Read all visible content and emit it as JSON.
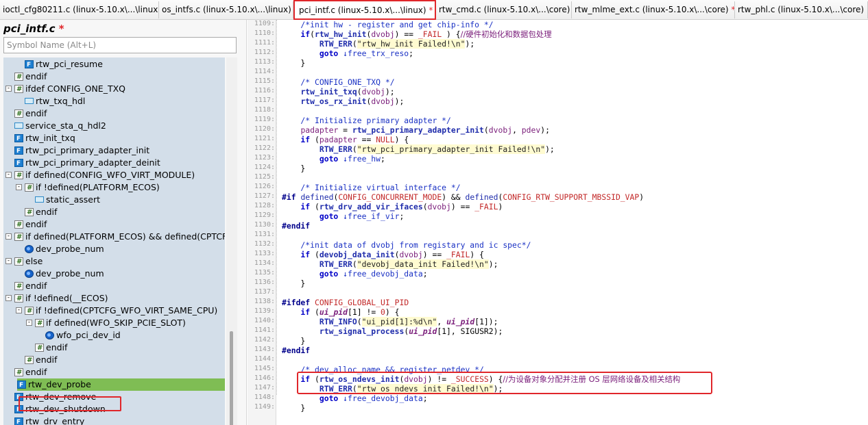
{
  "tabs": [
    {
      "label": "ioctl_cfg80211.c (linux-5.10.x\\...\\linux)",
      "active": false,
      "modified": false
    },
    {
      "label": "os_intfs.c (linux-5.10.x\\...\\linux)",
      "active": false,
      "modified": false
    },
    {
      "label": "pci_intf.c (linux-5.10.x\\...\\linux)",
      "active": true,
      "modified": true
    },
    {
      "label": "rtw_cmd.c (linux-5.10.x\\...\\core)",
      "active": false,
      "modified": false
    },
    {
      "label": "rtw_mlme_ext.c (linux-5.10.x\\...\\core)",
      "active": false,
      "modified": true
    },
    {
      "label": "rtw_phl.c (linux-5.10.x\\...\\core)",
      "active": false,
      "modified": false
    }
  ],
  "tab_symbols": {
    "modified": "*",
    "close": "×"
  },
  "panel": {
    "file_title": "pci_intf.c",
    "dirty_mark": "*",
    "search_placeholder": "Symbol Name (Alt+L)"
  },
  "tree": [
    {
      "label": "rtw_pci_resume",
      "icon": "function-icon"
    },
    {
      "label": "endif",
      "icon": "preprocessor-icon"
    },
    {
      "label": "ifdef CONFIG_ONE_TXQ",
      "icon": "preprocessor-icon",
      "toggle": "-"
    },
    {
      "label": "rtw_txq_hdl",
      "icon": "type-icon"
    },
    {
      "label": "endif",
      "icon": "preprocessor-icon"
    },
    {
      "label": "service_sta_q_hdl2",
      "icon": "type-icon"
    },
    {
      "label": "rtw_init_txq",
      "icon": "function-icon"
    },
    {
      "label": "rtw_pci_primary_adapter_init",
      "icon": "function-icon"
    },
    {
      "label": "rtw_pci_primary_adapter_deinit",
      "icon": "function-icon"
    },
    {
      "label": "if defined(CONFIG_WFO_VIRT_MODULE)",
      "icon": "preprocessor-icon",
      "toggle": "-"
    },
    {
      "label": "if !defined(PLATFORM_ECOS)",
      "icon": "preprocessor-icon",
      "toggle": "-"
    },
    {
      "label": "static_assert",
      "icon": "type-icon"
    },
    {
      "label": "endif",
      "icon": "preprocessor-icon"
    },
    {
      "label": "endif",
      "icon": "preprocessor-icon"
    },
    {
      "label": "if defined(PLATFORM_ECOS) && defined(CPTCFG_WFO_VIRT_MODULE)",
      "icon": "preprocessor-icon",
      "toggle": "-"
    },
    {
      "label": "dev_probe_num",
      "icon": "extern-icon"
    },
    {
      "label": "else",
      "icon": "preprocessor-icon",
      "toggle": "-"
    },
    {
      "label": "dev_probe_num",
      "icon": "extern-icon"
    },
    {
      "label": "endif",
      "icon": "preprocessor-icon"
    },
    {
      "label": "if !defined(__ECOS)",
      "icon": "preprocessor-icon",
      "toggle": "-"
    },
    {
      "label": "if !defined(CPTCFG_WFO_VIRT_SAME_CPU)",
      "icon": "preprocessor-icon",
      "toggle": "-"
    },
    {
      "label": "if defined(WFO_SKIP_PCIE_SLOT)",
      "icon": "preprocessor-icon",
      "toggle": "-"
    },
    {
      "label": "wfo_pci_dev_id",
      "icon": "extern-icon"
    },
    {
      "label": "endif",
      "icon": "preprocessor-icon"
    },
    {
      "label": "endif",
      "icon": "preprocessor-icon"
    },
    {
      "label": "endif",
      "icon": "preprocessor-icon"
    },
    {
      "label": "rtw_dev_probe",
      "icon": "function-icon",
      "selected": true
    },
    {
      "label": "rtw_dev_remove",
      "icon": "function-icon"
    },
    {
      "label": "rtw_dev_shutdown",
      "icon": "function-icon"
    },
    {
      "label": "rtw_drv_entry",
      "icon": "function-icon"
    }
  ],
  "line_numbers": [
    "1109:",
    "1110:",
    "1111:",
    "1112:",
    "1113:",
    "1114:",
    "1115:",
    "1116:",
    "1117:",
    "1118:",
    "1119:",
    "1120:",
    "1121:",
    "1122:",
    "1123:",
    "1124:",
    "1125:",
    "1126:",
    "1127:",
    "1128:",
    "1129:",
    "1130:",
    "1131:",
    "1132:",
    "1133:",
    "1134:",
    "1135:",
    "1136:",
    "1137:",
    "1138:",
    "1139:",
    "1140:",
    "1141:",
    "1142:",
    "1143:",
    "1144:",
    "1145:",
    "1146:",
    "1147:",
    "1148:",
    "1149:"
  ],
  "code": [
    [
      [
        "c",
        "\t/*init hw - register and get chip-info */"
      ]
    ],
    [
      [
        "k",
        "\tif"
      ],
      [
        "",
        "("
      ],
      [
        "fn2",
        "rtw_hw_init"
      ],
      [
        "",
        "("
      ],
      [
        "v",
        "dvobj"
      ],
      [
        "",
        ") == "
      ],
      [
        "m",
        "_FAIL"
      ],
      [
        "",
        " ) {"
      ],
      [
        "cz",
        "//硬件初始化和数据包处理"
      ]
    ],
    [
      [
        "",
        "\t\t"
      ],
      [
        "fn2",
        "RTW_ERR"
      ],
      [
        "",
        "("
      ],
      [
        "s",
        "\"rtw_hw_init Failed!\\n\""
      ],
      [
        "",
        ");"
      ]
    ],
    [
      [
        "k",
        "\t\tgoto"
      ],
      [
        "",
        " "
      ],
      [
        "gt",
        "↓free_trx_reso"
      ],
      [
        "",
        ";"
      ]
    ],
    [
      [
        "",
        "\t}"
      ]
    ],
    [
      [
        "",
        ""
      ]
    ],
    [
      [
        "c",
        "\t/* CONFIG_ONE_TXQ */"
      ]
    ],
    [
      [
        "",
        "\t"
      ],
      [
        "fn2",
        "rtw_init_txq"
      ],
      [
        "",
        "("
      ],
      [
        "v",
        "dvobj"
      ],
      [
        "",
        ");"
      ]
    ],
    [
      [
        "",
        "\t"
      ],
      [
        "fn2",
        "rtw_os_rx_init"
      ],
      [
        "",
        "("
      ],
      [
        "v",
        "dvobj"
      ],
      [
        "",
        ");"
      ]
    ],
    [
      [
        "",
        ""
      ]
    ],
    [
      [
        "c",
        "\t/* Initialize primary adapter */"
      ]
    ],
    [
      [
        "",
        "\t"
      ],
      [
        "v",
        "padapter"
      ],
      [
        "",
        " = "
      ],
      [
        "fn2",
        "rtw_pci_primary_adapter_init"
      ],
      [
        "",
        "("
      ],
      [
        "v",
        "dvobj"
      ],
      [
        "",
        ", "
      ],
      [
        "v",
        "pdev"
      ],
      [
        "",
        ");"
      ]
    ],
    [
      [
        "k",
        "\tif"
      ],
      [
        "",
        " ("
      ],
      [
        "v",
        "padapter"
      ],
      [
        "",
        " == "
      ],
      [
        "m",
        "NULL"
      ],
      [
        "",
        ") {"
      ]
    ],
    [
      [
        "",
        "\t\t"
      ],
      [
        "fn2",
        "RTW_ERR"
      ],
      [
        "",
        "("
      ],
      [
        "s",
        "\"rtw_pci_primary_adapter_init Failed!\\n\""
      ],
      [
        "",
        ");"
      ]
    ],
    [
      [
        "k",
        "\t\tgoto"
      ],
      [
        "",
        " "
      ],
      [
        "gt",
        "↓free_hw"
      ],
      [
        "",
        ";"
      ]
    ],
    [
      [
        "",
        "\t}"
      ]
    ],
    [
      [
        "",
        ""
      ]
    ],
    [
      [
        "c",
        "\t/* Initialize virtual interface */"
      ]
    ],
    [
      [
        "pp",
        "#if"
      ],
      [
        "",
        " "
      ],
      [
        "fn3",
        "defined"
      ],
      [
        "",
        "("
      ],
      [
        "m",
        "CONFIG_CONCURRENT_MODE"
      ],
      [
        "",
        ") && "
      ],
      [
        "fn3",
        "defined"
      ],
      [
        "",
        "("
      ],
      [
        "m",
        "CONFIG_RTW_SUPPORT_MBSSID_VAP"
      ],
      [
        "",
        ")"
      ]
    ],
    [
      [
        "k",
        "\tif"
      ],
      [
        "",
        " ("
      ],
      [
        "fn2",
        "rtw_drv_add_vir_ifaces"
      ],
      [
        "",
        "("
      ],
      [
        "v",
        "dvobj"
      ],
      [
        "",
        ") == "
      ],
      [
        "m",
        "_FAIL"
      ],
      [
        "",
        ")"
      ]
    ],
    [
      [
        "k",
        "\t\tgoto"
      ],
      [
        "",
        " "
      ],
      [
        "gt",
        "↓free_if_vir"
      ],
      [
        "",
        ";"
      ]
    ],
    [
      [
        "pp",
        "#endif"
      ]
    ],
    [
      [
        "",
        ""
      ]
    ],
    [
      [
        "c",
        "\t/*init data of dvobj from registary and ic spec*/"
      ]
    ],
    [
      [
        "k",
        "\tif"
      ],
      [
        "",
        " ("
      ],
      [
        "fn2",
        "devobj_data_init"
      ],
      [
        "",
        "("
      ],
      [
        "v",
        "dvobj"
      ],
      [
        "",
        ") == "
      ],
      [
        "m",
        "_FAIL"
      ],
      [
        "",
        ") {"
      ]
    ],
    [
      [
        "",
        "\t\t"
      ],
      [
        "fn2",
        "RTW_ERR"
      ],
      [
        "",
        "("
      ],
      [
        "s",
        "\"devobj_data_init Failed!\\n\""
      ],
      [
        "",
        ");"
      ]
    ],
    [
      [
        "k",
        "\t\tgoto"
      ],
      [
        "",
        " "
      ],
      [
        "gt",
        "↓free_devobj_data"
      ],
      [
        "",
        ";"
      ]
    ],
    [
      [
        "",
        "\t}"
      ]
    ],
    [
      [
        "",
        ""
      ]
    ],
    [
      [
        "pp",
        "#ifdef"
      ],
      [
        "",
        " "
      ],
      [
        "m",
        "CONFIG_GLOBAL_UI_PID"
      ]
    ],
    [
      [
        "k",
        "\tif"
      ],
      [
        "",
        " ("
      ],
      [
        "it",
        "ui_pid"
      ],
      [
        "",
        "[1] != "
      ],
      [
        "m",
        "0"
      ],
      [
        "",
        ") {"
      ]
    ],
    [
      [
        "",
        "\t\t"
      ],
      [
        "fn2",
        "RTW_INFO"
      ],
      [
        "",
        "("
      ],
      [
        "s",
        "\"ui_pid[1]:%d\\n\""
      ],
      [
        "",
        ", "
      ],
      [
        "it",
        "ui_pid"
      ],
      [
        "",
        "[1]);"
      ]
    ],
    [
      [
        "",
        "\t\t"
      ],
      [
        "fn2",
        "rtw_signal_process"
      ],
      [
        "",
        "("
      ],
      [
        "it",
        "ui_pid"
      ],
      [
        "",
        "[1], SIGUSR2);"
      ]
    ],
    [
      [
        "",
        "\t}"
      ]
    ],
    [
      [
        "pp",
        "#endif"
      ]
    ],
    [
      [
        "",
        ""
      ]
    ],
    [
      [
        "c",
        "\t/* dev_alloc_name && register_netdev */"
      ]
    ],
    [
      [
        "k",
        "\tif"
      ],
      [
        "",
        " ("
      ],
      [
        "fn2",
        "rtw_os_ndevs_init"
      ],
      [
        "",
        "("
      ],
      [
        "v",
        "dvobj"
      ],
      [
        "",
        ") != "
      ],
      [
        "m",
        "_SUCCESS"
      ],
      [
        "",
        ") {"
      ],
      [
        "cz",
        "//为设备对象分配并注册 OS 层网络设备及相关结构"
      ]
    ],
    [
      [
        "",
        "\t\t"
      ],
      [
        "fn2",
        "RTW_ERR"
      ],
      [
        "",
        "("
      ],
      [
        "s",
        "\"rtw_os_ndevs_init Failed!\\n\""
      ],
      [
        "",
        ");"
      ]
    ],
    [
      [
        "k",
        "\t\tgoto"
      ],
      [
        "",
        " "
      ],
      [
        "gt",
        "↓free_devobj_data"
      ],
      [
        "",
        ";"
      ]
    ],
    [
      [
        "",
        "\t}"
      ]
    ]
  ]
}
